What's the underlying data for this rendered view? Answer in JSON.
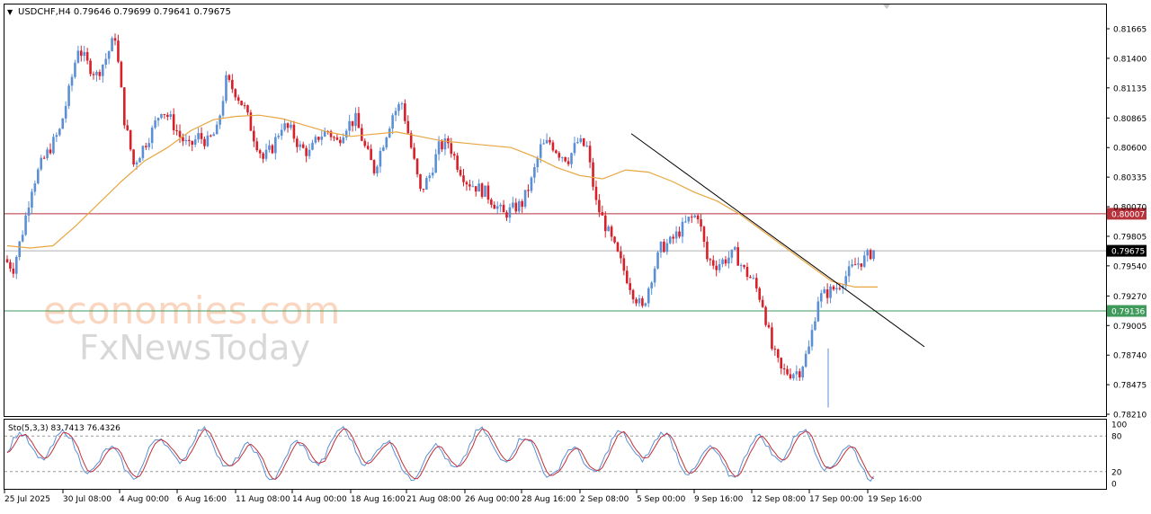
{
  "header": {
    "symbol_line": "USDCHF,H4  0.79646 0.79699 0.79641 0.79675"
  },
  "watermark": {
    "line1": "economies.com",
    "line2": "FxNewsToday"
  },
  "colors": {
    "bull": "#5b8fd6",
    "bear": "#d6202a",
    "ma": "#e8a640",
    "trendline": "#000000",
    "resistance": "#b8323c",
    "support": "#3f9a5c",
    "stoch_main": "#5b8fd6",
    "stoch_signal": "#c0303a"
  },
  "chart_data": [
    {
      "type": "candlestick",
      "title": "USDCHF,H4",
      "ohlc_last": {
        "open": 0.79646,
        "high": 0.79699,
        "low": 0.79641,
        "close": 0.79675
      },
      "ylim": [
        0.7815,
        0.819
      ],
      "y_ticks": [
        "0.81665",
        "0.81400",
        "0.81135",
        "0.80865",
        "0.80600",
        "0.80335",
        "0.80070",
        "0.79805",
        "0.79540",
        "0.79270",
        "0.79005",
        "0.78740",
        "0.78475",
        "0.78210"
      ],
      "x_ticks": [
        "25 Jul 2025",
        "30 Jul 08:00",
        "4 Aug 00:00",
        "6 Aug 16:00",
        "11 Aug 08:00",
        "14 Aug 00:00",
        "18 Aug 16:00",
        "21 Aug 08:00",
        "26 Aug 00:00",
        "28 Aug 16:00",
        "2 Sep 08:00",
        "5 Sep 00:00",
        "9 Sep 16:00",
        "12 Sep 08:00",
        "17 Sep 00:00",
        "19 Sep 16:00"
      ],
      "price_labels": {
        "resistance": {
          "value": 0.80007,
          "label": "0.80007"
        },
        "current": {
          "value": 0.79675,
          "label": "0.79675"
        },
        "support": {
          "value": 0.79136,
          "label": "0.79136"
        }
      },
      "close_path": [
        0.796,
        0.7952,
        0.7985,
        0.8025,
        0.8045,
        0.806,
        0.8075,
        0.811,
        0.815,
        0.8135,
        0.8125,
        0.814,
        0.816,
        0.8085,
        0.8045,
        0.806,
        0.8075,
        0.8095,
        0.8085,
        0.807,
        0.806,
        0.807,
        0.8065,
        0.8075,
        0.812,
        0.811,
        0.8095,
        0.807,
        0.805,
        0.806,
        0.808,
        0.8075,
        0.806,
        0.8055,
        0.807,
        0.8075,
        0.8065,
        0.808,
        0.8085,
        0.806,
        0.804,
        0.8065,
        0.809,
        0.81,
        0.806,
        0.802,
        0.8035,
        0.806,
        0.8065,
        0.8045,
        0.803,
        0.8025,
        0.802,
        0.801,
        0.8,
        0.8005,
        0.801,
        0.803,
        0.806,
        0.8065,
        0.8055,
        0.805,
        0.8065,
        0.806,
        0.801,
        0.799,
        0.797,
        0.795,
        0.793,
        0.7915,
        0.7945,
        0.797,
        0.7975,
        0.7985,
        0.7995,
        0.8,
        0.796,
        0.7955,
        0.796,
        0.7965,
        0.795,
        0.794,
        0.792,
        0.788,
        0.786,
        0.7858,
        0.786,
        0.788,
        0.7925,
        0.793,
        0.7935,
        0.7945,
        0.7955,
        0.796,
        0.7968
      ],
      "ma_path": [
        0.7972,
        0.797,
        0.7972,
        0.799,
        0.801,
        0.803,
        0.8048,
        0.806,
        0.8075,
        0.8085,
        0.8088,
        0.8089,
        0.8086,
        0.808,
        0.8074,
        0.807,
        0.8072,
        0.8074,
        0.807,
        0.8066,
        0.8064,
        0.8062,
        0.806,
        0.8052,
        0.8042,
        0.8035,
        0.8032,
        0.804,
        0.8038,
        0.803,
        0.802,
        0.8012,
        0.8,
        0.7985,
        0.797,
        0.7955,
        0.794,
        0.7935,
        0.7935
      ],
      "trendline": {
        "start_price": 0.80725,
        "end_price": 0.78815
      },
      "series": [
        {
          "name": "Sto(5,3,3)",
          "values": [
            83.7413
          ]
        },
        {
          "name": "signal",
          "values": [
            76.4326
          ]
        }
      ]
    },
    {
      "type": "line",
      "title": "Sto(5,3,3) 83.7413 76.4326",
      "ylim": [
        0,
        100
      ],
      "y_ticks": [
        "100",
        "80",
        "20",
        "0"
      ],
      "levels": [
        80,
        20
      ]
    }
  ]
}
